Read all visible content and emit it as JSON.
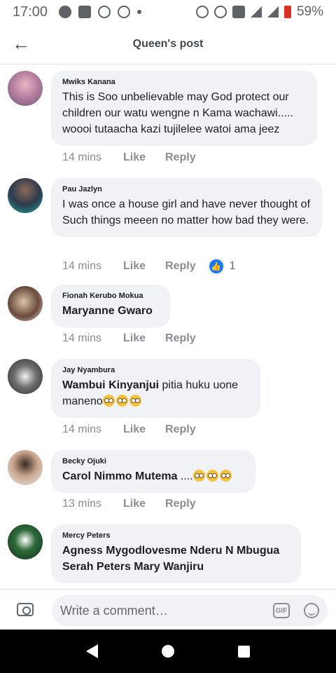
{
  "status_bar": {
    "time": "17:00",
    "battery": "59%",
    "left_icons": [
      "messenger-icon",
      "n-app-icon",
      "settings-app-icon",
      "whatsapp-icon",
      "dot-icon"
    ],
    "right_icons": [
      "alarm-icon",
      "sync-icon",
      "vibrate-icon",
      "signal-icon",
      "signal-h-plus-icon",
      "battery-icon"
    ]
  },
  "header": {
    "title": "Queen's post",
    "back_icon": "arrow-left-icon"
  },
  "comments": [
    {
      "author": "Mwiks Kanana",
      "text": "This is Soo unbelievable may God protect our children our watu wengne n Kama wachawi..... woooi tutaacha kazi tujilelee watoi ama jeez",
      "time": "14 mins",
      "like": "Like",
      "reply": "Reply"
    },
    {
      "author": "Pau Jazlyn",
      "text": "I was once a house girl and have never thought of Such things meeen no matter how bad  they were.",
      "time": "14 mins",
      "like": "Like",
      "reply": "Reply",
      "reaction_count": "1"
    },
    {
      "author": "Fionah Kerubo Mokua",
      "tag": "Maryanne Gwaro",
      "time": "14 mins",
      "like": "Like",
      "reply": "Reply"
    },
    {
      "author": "Jay Nyambura",
      "tag": "Wambui Kinyanjui",
      "text_line1": "  pitia huku uone",
      "text_line2": "maneno",
      "time": "14 mins",
      "like": "Like",
      "reply": "Reply"
    },
    {
      "author": "Becky Ojuki",
      "tag": "Carol Nimmo Mutema",
      "text": " ....",
      "time": "13 mins",
      "like": "Like",
      "reply": "Reply"
    },
    {
      "author": "Mercy Peters",
      "tag_line1": "Agness Mygodlovesme  Nderu N Mbugua",
      "tag_line2": "Serah Peters Mary Wanjiru"
    }
  ],
  "composer": {
    "placeholder": "Write a comment…",
    "gif_label": "GIF"
  },
  "colors": {
    "bubble": "#f0f2f5",
    "meta_text": "#8a8d91",
    "like_blue": "#1877f2",
    "battery_red": "#d93025"
  }
}
